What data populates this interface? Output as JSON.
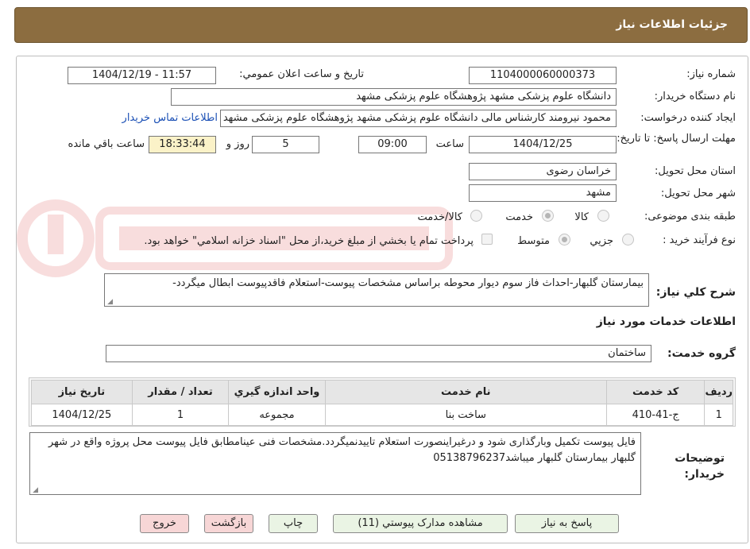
{
  "header": {
    "title": "جزئیات اطلاعات نیاز"
  },
  "form": {
    "need_number_label": "شماره نیاز:",
    "need_number": "1104000060000373",
    "announce_label": "تاریخ و ساعت اعلان عمومي:",
    "announce_value": "1404/12/19 - 11:57",
    "buyer_org_label": "نام دستگاه خريدار:",
    "buyer_org": "دانشگاه علوم پزشکی مشهد   پژوهشگاه علوم پزشکی مشهد",
    "requester_label": "ايجاد کننده درخواست:",
    "requester": "محمود نیرومند کارشناس مالی دانشگاه علوم پزشکی مشهد   پژوهشگاه علوم پزشکی مشهد",
    "contact_link": "اطلاعات تماس خريدار",
    "deadline_label": "مهلت ارسال پاسخ: تا تاريخ:",
    "deadline_date": "1404/12/25",
    "time_label": "ساعت",
    "deadline_time": "09:00",
    "days": "5",
    "days_label": "روز و",
    "remaining_time": "18:33:44",
    "remaining_label": "ساعت باقي مانده",
    "province_label": "استان محل تحويل:",
    "province": "خراسان رضوی",
    "city_label": "شهر محل تحويل:",
    "city": "مشهد",
    "category_label": "طبقه بندی موضوعی:",
    "category_options": {
      "goods": "کالا",
      "service": "خدمت",
      "goods_service": "کالا/خدمت"
    },
    "process_label": "نوع فرآيند خريد :",
    "process_options": {
      "partial": "جزيي",
      "medium": "متوسط"
    },
    "payment_note": "پرداخت تمام يا بخشي از مبلغ خريد،از محل \"اسناد خزانه اسلامي\" خواهد بود.",
    "description_label": "شرح کلي نياز:",
    "description": "بیمارستان گلبهار-احداث فاز سوم دیوار محوطه براساس مشخصات پیوست-استعلام فاقدپیوست ابطال میگردد-"
  },
  "services": {
    "section_title": "اطلاعات خدمات مورد نياز",
    "group_label": "گروه خدمت:",
    "group_value": "ساختمان",
    "columns": [
      "رديف",
      "کد خدمت",
      "نام خدمت",
      "واحد اندازه گيري",
      "تعداد / مقدار",
      "تاريخ نياز"
    ],
    "rows": [
      [
        "1",
        "ج-41-410",
        "ساخت بنا",
        "مجموعه",
        "1",
        "1404/12/25"
      ]
    ]
  },
  "notes": {
    "label": "توضيحات خريدار:",
    "text": "فایل پیوست تکمیل وبارگذاری شود و درغیراینصورت استعلام تاییدنمیگردد.مشخصات فنی عینامطابق فایل پیوست محل پروژه واقع در شهر گلبهار بیمارستان گلبهار میباشد05138796237"
  },
  "buttons": {
    "respond": "پاسخ به نياز",
    "attachments": "مشاهده مدارک پيوستي (11)",
    "print": "چاپ",
    "back": "بازگشت",
    "exit": "خروج"
  }
}
